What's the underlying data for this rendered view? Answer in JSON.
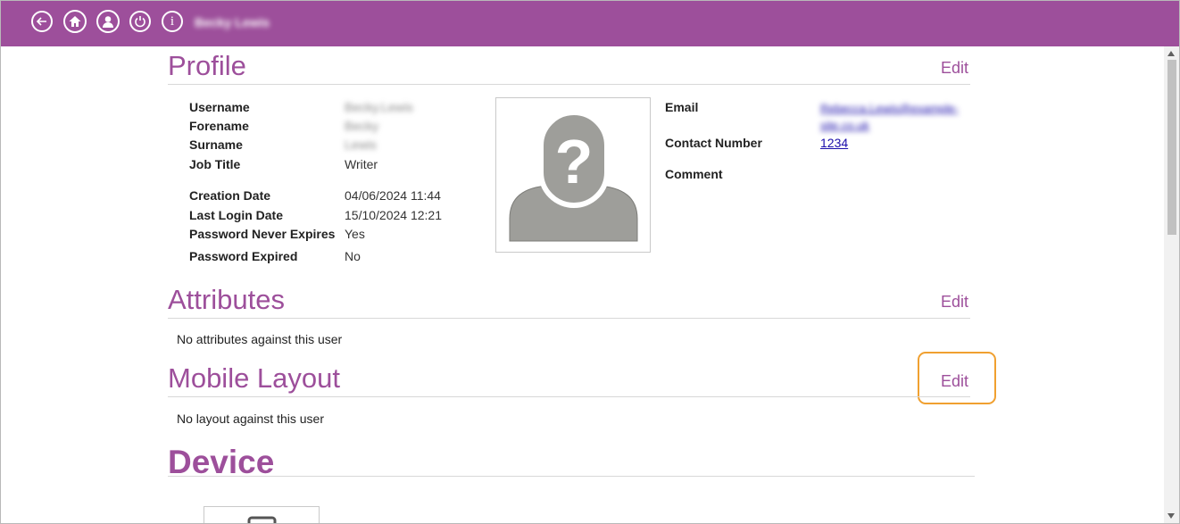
{
  "header": {
    "user_display_name": "Becky Lewis",
    "icons": [
      "back-arrow-icon",
      "home-icon",
      "user-icon",
      "power-icon",
      "info-icon"
    ]
  },
  "profile": {
    "title": "Profile",
    "edit_label": "Edit",
    "fields": [
      {
        "label": "Username",
        "value": "Becky.Lewis"
      },
      {
        "label": "Forename",
        "value": "Becky"
      },
      {
        "label": "Surname",
        "value": "Lewis"
      },
      {
        "label": "Job Title",
        "value": "Writer"
      }
    ],
    "dates": [
      {
        "label": "Creation Date",
        "value": "04/06/2024 11:44"
      },
      {
        "label": "Last Login Date",
        "value": "15/10/2024 12:21"
      },
      {
        "label": "Password Never Expires",
        "value": "Yes"
      },
      {
        "label": "Password Expired",
        "value": "No"
      }
    ],
    "email_label": "Email",
    "email_value": "Rebecca.Lewis@example-site.co.uk",
    "contact_label": "Contact Number",
    "contact_value": "1234",
    "comment_label": "Comment"
  },
  "attributes": {
    "title": "Attributes",
    "edit_label": "Edit",
    "empty_message": "No attributes against this user"
  },
  "mobile_layout": {
    "title": "Mobile Layout",
    "edit_label": "Edit",
    "empty_message": "No layout against this user"
  },
  "device": {
    "title": "Device"
  },
  "colors": {
    "brand": "#9d4f9b",
    "highlight": "#f0a030",
    "link": "#1a0dab"
  }
}
